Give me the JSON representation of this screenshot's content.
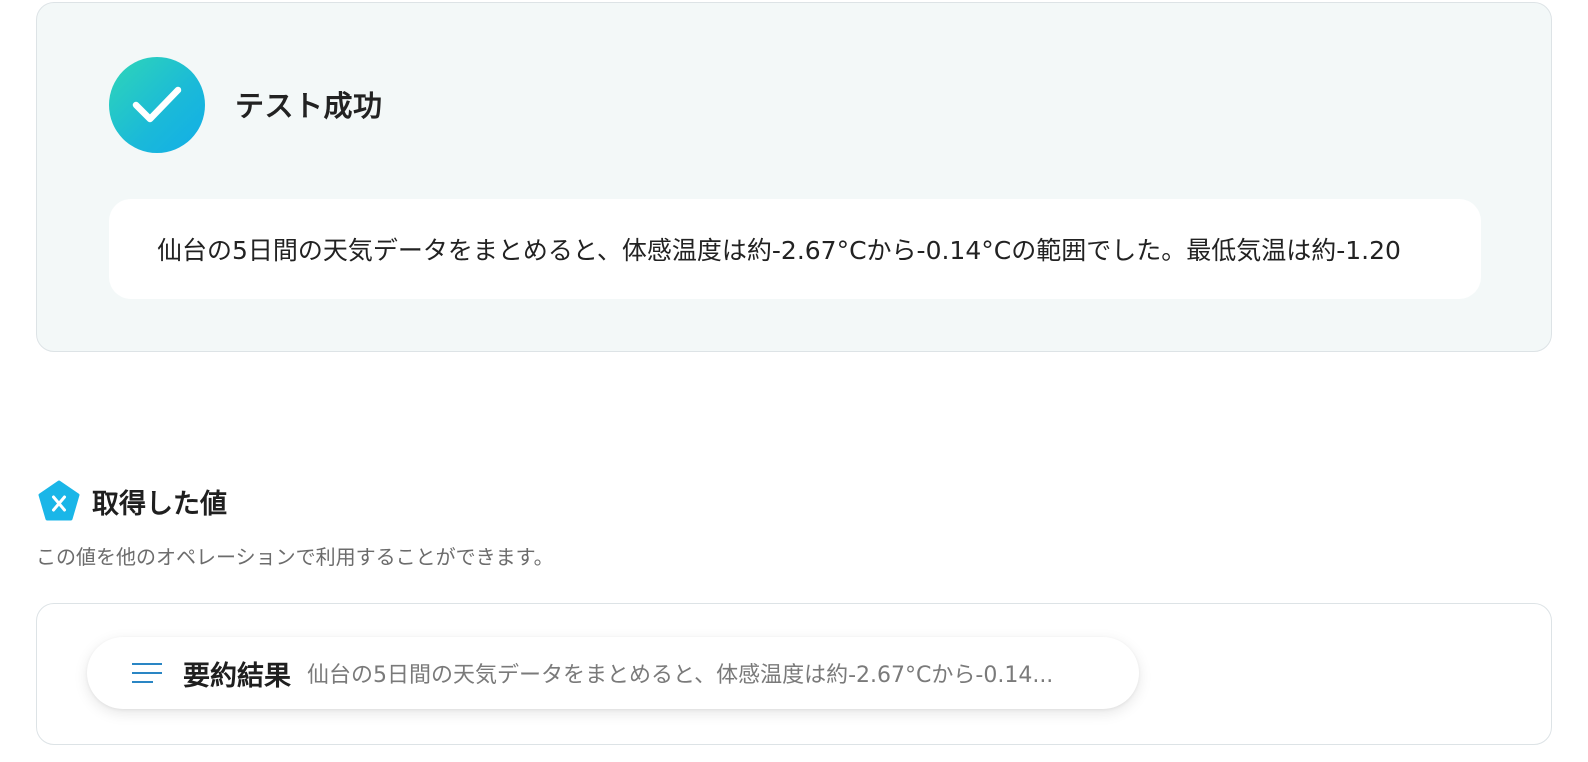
{
  "result": {
    "status_title": "テスト成功",
    "output_text": "仙台の5日間の天気データをまとめると、体感温度は約-2.67°Cから-0.14°Cの範囲でした。最低気温は約-1.20"
  },
  "variables": {
    "title": "取得した値",
    "description": "この値を他のオペレーションで利用することができます。",
    "items": [
      {
        "name": "要約結果",
        "value": "仙台の5日間の天気データをまとめると、体感温度は約-2.67°Cから-0.14..."
      }
    ]
  },
  "colors": {
    "success_gradient_start": "#2fd6b7",
    "success_gradient_end": "#12aee8",
    "variable_icon": "#1ab6e8",
    "lines_icon": "#2a86c4"
  },
  "icons": {
    "status": "check-icon",
    "variables": "variable-x-pentagon-icon",
    "item": "text-lines-icon"
  }
}
